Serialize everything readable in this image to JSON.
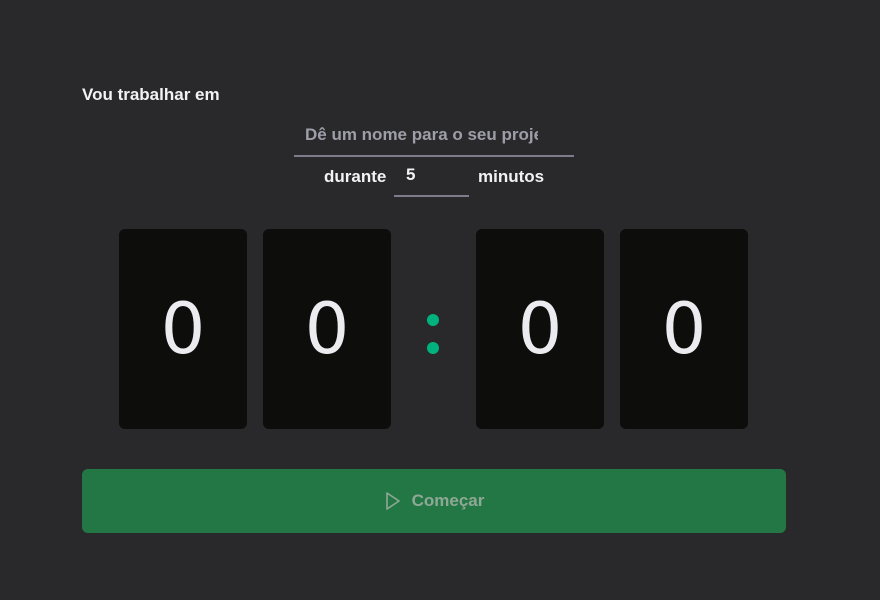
{
  "form": {
    "title": "Vou trabalhar em",
    "project_placeholder": "Dê um nome para o seu projeto",
    "project_value": "",
    "duration_label": "durante",
    "minutes_value": "5",
    "minutes_label": "minutos"
  },
  "countdown": {
    "minutes_tens": "0",
    "minutes_ones": "0",
    "separator": ":",
    "seconds_tens": "0",
    "seconds_ones": "0"
  },
  "start_button": {
    "label": "Começar",
    "icon": "play-icon",
    "disabled": true
  },
  "colors": {
    "background": "#29292b",
    "digit_card": "#0d0d0c",
    "accent": "#00b37e",
    "separator": "#00b37e",
    "button_disabled": "#237745",
    "button_text_disabled": "#8fa896"
  }
}
